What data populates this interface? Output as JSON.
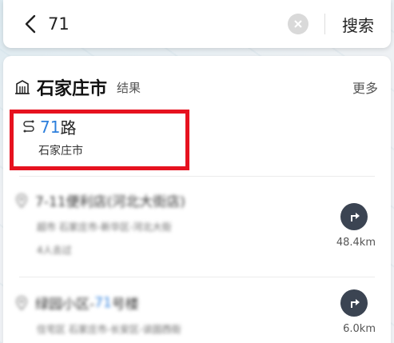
{
  "search": {
    "query": "71",
    "button_label": "搜索"
  },
  "city": {
    "name": "石家庄市",
    "suffix": "结果",
    "more_label": "更多"
  },
  "route": {
    "number": "71",
    "word": "路",
    "city": "石家庄市"
  },
  "results": [
    {
      "title": "7-11便利店(河北大街店)",
      "line1": "超市 石家庄市-新华区-河北大街",
      "line2": "4人去过",
      "distance": "48.4km"
    },
    {
      "title_pre": "绿园小区-",
      "title_num": "71",
      "title_post": "号楼",
      "line1": "住宅区 石家庄市-长安区-谈固西街",
      "distance": "6.0km"
    }
  ],
  "colors": {
    "accent": "#2d7fdc",
    "highlight_box": "#e6121f",
    "nav_button": "#3b4452"
  }
}
